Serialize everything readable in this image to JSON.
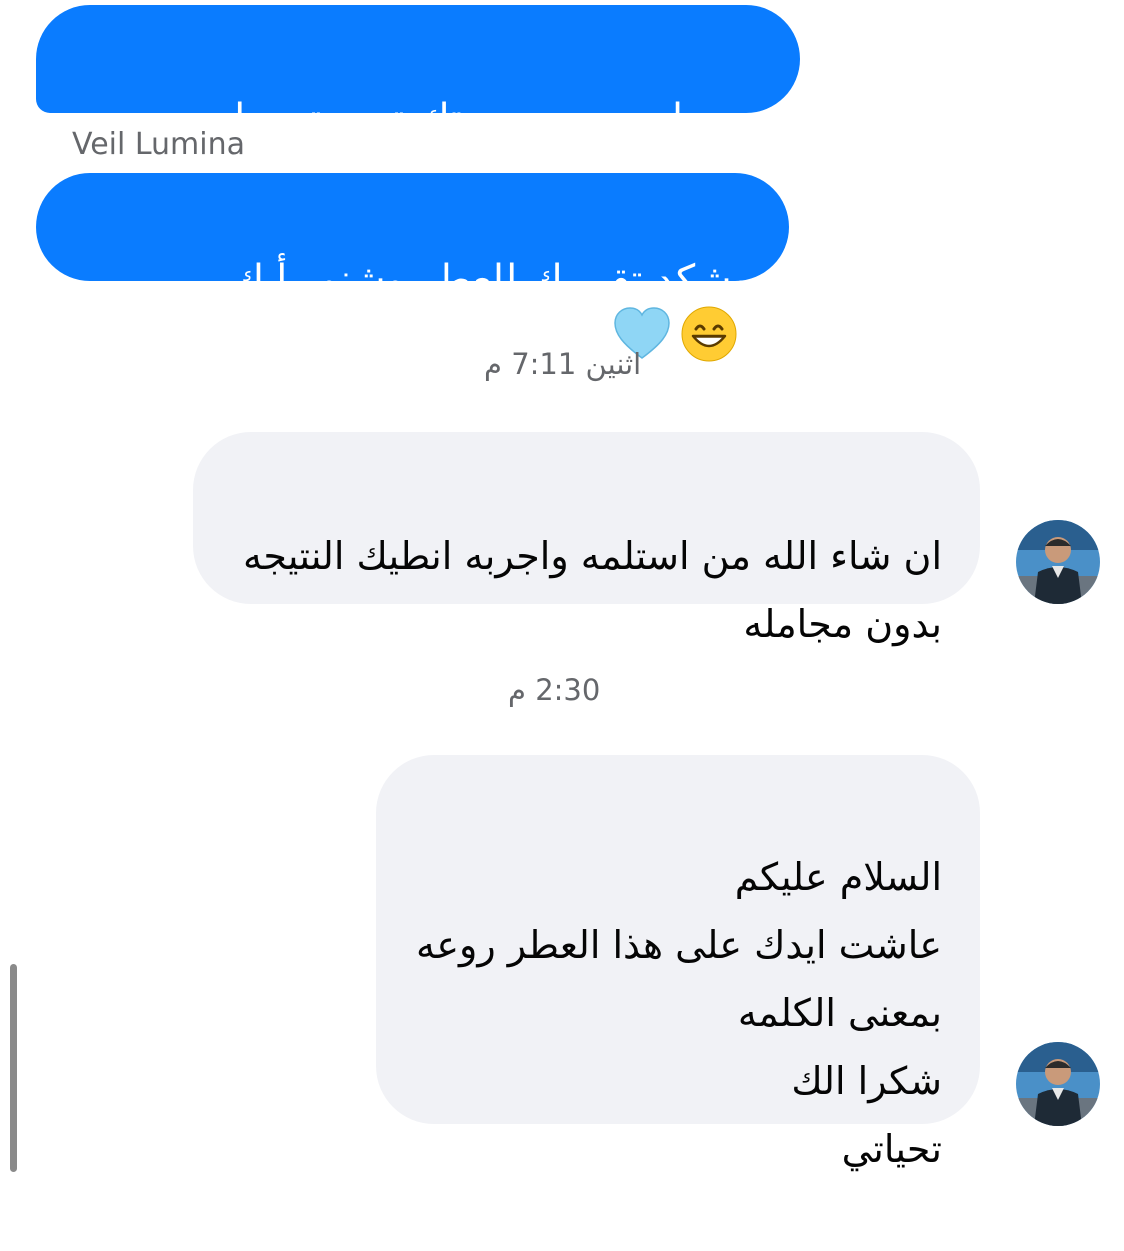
{
  "thread": {
    "messages": [
      {
        "type": "outgoing",
        "text": "بس اريد من حضرتك تجي تحجيلي تجربتك"
      },
      {
        "type": "sender_label",
        "text": "Veil Lumina"
      },
      {
        "type": "outgoing",
        "text": "وشكد تقييمك للعطر وشنو رأيك بي",
        "emojis": [
          "grinning-face-emoji",
          "light-blue-heart-emoji"
        ]
      },
      {
        "type": "timestamp",
        "text": "اثنين 7:11 م"
      },
      {
        "type": "incoming",
        "text": "ان شاء الله من استلمه واجربه انطيك النتيجه\nبدون مجامله"
      },
      {
        "type": "timestamp",
        "text": "2:30 م"
      },
      {
        "type": "incoming",
        "text": "السلام عليكم\nعاشت ايدك على هذا العطر روعه\nبمعنى الكلمه\nشكرا الك\nتحياتي"
      }
    ]
  },
  "colors": {
    "outgoing_bubble": "#0a7cff",
    "incoming_bubble": "#f1f2f6",
    "meta_text": "#65676b"
  }
}
